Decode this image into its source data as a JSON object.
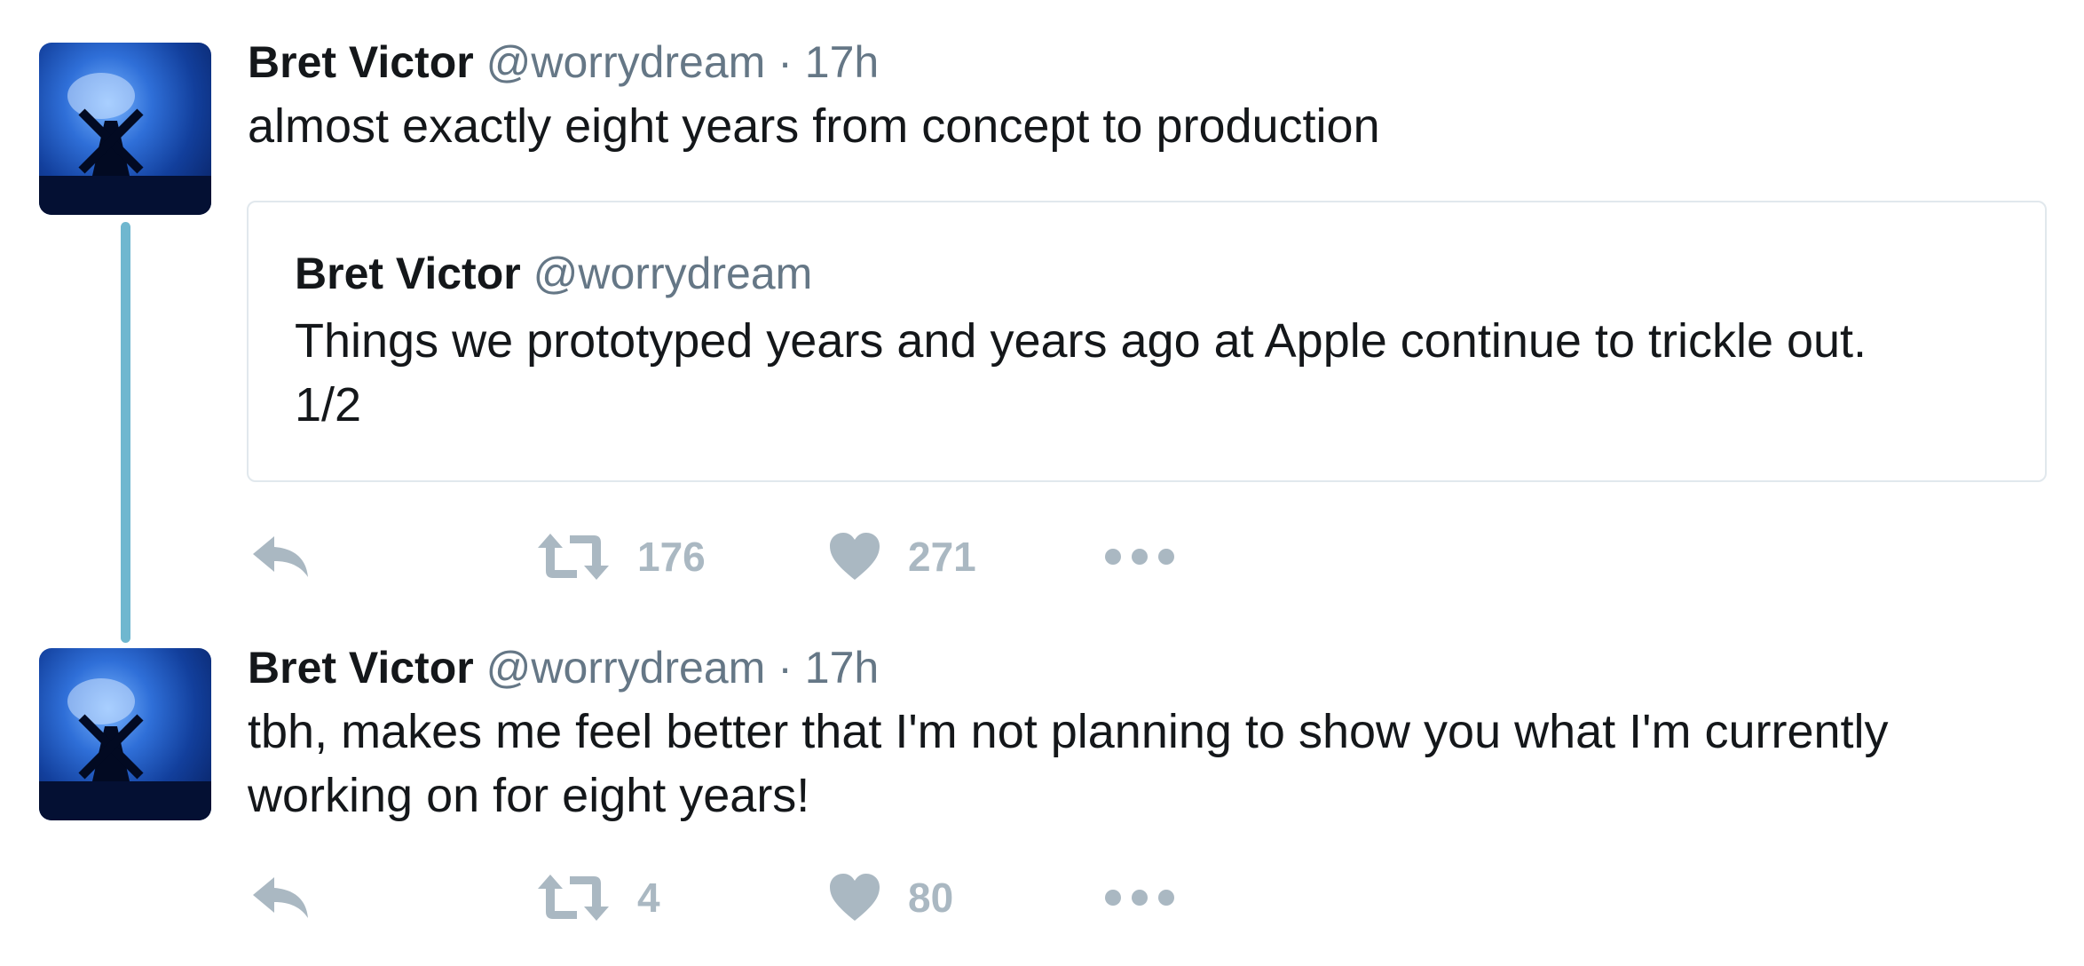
{
  "tweets": [
    {
      "name": "Bret Victor",
      "handle": "@worrydream",
      "separator": "·",
      "time": "17h",
      "text": "almost exactly eight years from concept to production",
      "quote": {
        "name": "Bret Victor",
        "handle": "@worrydream",
        "text_line1": "Things we prototyped years and years ago at Apple continue to trickle out.",
        "text_line2": "1/2"
      },
      "retweet_count": "176",
      "like_count": "271"
    },
    {
      "name": "Bret Victor",
      "handle": "@worrydream",
      "separator": "·",
      "time": "17h",
      "text_line1": "tbh, makes me feel better that I'm not planning to show you what I'm currently",
      "text_line2": "working on for eight years!",
      "retweet_count": "4",
      "like_count": "80"
    }
  ],
  "icons": {
    "reply": "reply-icon",
    "retweet": "retweet-icon",
    "like": "heart-icon",
    "more": "more-icon"
  },
  "colors": {
    "text": "#14171a",
    "secondary": "#657786",
    "action": "#aab8c2",
    "thread_line": "#6fb7cf",
    "card_border": "#e1e8ed"
  }
}
